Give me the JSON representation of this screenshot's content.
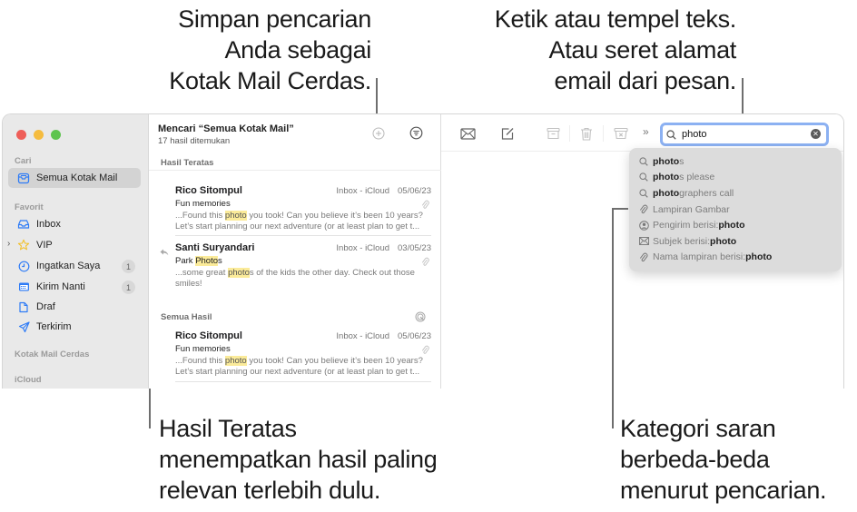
{
  "callouts": {
    "save_search": [
      "Simpan pencarian",
      "Anda sebagai",
      "Kotak Mail Cerdas."
    ],
    "type_paste": [
      "Ketik atau tempel teks.",
      "Atau seret alamat",
      "email dari pesan."
    ],
    "top_hits": [
      "Hasil Teratas",
      "menempatkan hasil paling",
      "relevan terlebih dulu."
    ],
    "categories": [
      "Kategori saran",
      "berbeda-beda",
      "menurut pencarian."
    ]
  },
  "sidebar": {
    "sections": {
      "search": "Cari",
      "favorites": "Favorit",
      "smart_mailboxes": "Kotak Mail Cerdas",
      "icloud": "iCloud"
    },
    "search_item": {
      "label": "Semua Kotak Mail",
      "icon": "all-mailboxes-icon",
      "selected": true
    },
    "favorites": [
      {
        "label": "Inbox",
        "icon": "inbox-icon",
        "badge": null
      },
      {
        "label": "VIP",
        "icon": "star-icon",
        "badge": null
      },
      {
        "label": "Ingatkan Saya",
        "icon": "clock-icon",
        "badge": "1"
      },
      {
        "label": "Kirim Nanti",
        "icon": "calendar-icon",
        "badge": "1"
      },
      {
        "label": "Draf",
        "icon": "document-icon",
        "badge": null
      },
      {
        "label": "Terkirim",
        "icon": "paper-plane-icon",
        "badge": null
      }
    ]
  },
  "message_list": {
    "title": "Mencari “Semua Kotak Mail”",
    "subtitle": "17 hasil ditemukan",
    "top_hits_label": "Hasil Teratas",
    "all_results_label": "Semua Hasil",
    "top_hits": [
      {
        "from": "Rico Sitompul",
        "mailbox": "Inbox - iCloud",
        "date": "05/06/23",
        "subject": [
          "Fun memories"
        ],
        "preview": [
          "...Found this ",
          "photo",
          " you took! Can you believe it’s been 10 years? Let’s start planning our next adventure (or at least plan to get t..."
        ],
        "attachment": true,
        "replied": false
      },
      {
        "from": "Santi Suryandari",
        "mailbox": "Inbox - iCloud",
        "date": "03/05/23",
        "subject": [
          "Park ",
          "Photo",
          "s"
        ],
        "preview": [
          "...some great ",
          "photo",
          "s of the kids the other day. Check out those smiles!"
        ],
        "attachment": true,
        "replied": true
      }
    ],
    "all_results": [
      {
        "from": "Rico Sitompul",
        "mailbox": "Inbox - iCloud",
        "date": "05/06/23",
        "subject": [
          "Fun memories"
        ],
        "preview": [
          "...Found this ",
          "photo",
          " you took! Can you believe it’s been 10 years? Let’s start planning our next adventure (or at least plan to get t..."
        ],
        "attachment": true
      }
    ]
  },
  "toolbar": {
    "buttons": [
      "get-mail",
      "compose",
      "archive",
      "delete",
      "junk"
    ],
    "more": "»"
  },
  "search": {
    "value": "photo",
    "suggestions": [
      {
        "icon": "search-icon",
        "prefix": "",
        "bold": "photo",
        "rest": "s"
      },
      {
        "icon": "search-icon",
        "prefix": "",
        "bold": "photo",
        "rest": "s please"
      },
      {
        "icon": "search-icon",
        "prefix": "",
        "bold": "photo",
        "rest": "graphers call"
      },
      {
        "icon": "paperclip-icon",
        "prefix": "Lampiran Gambar",
        "bold": "",
        "rest": ""
      },
      {
        "icon": "person-icon",
        "prefix": "Pengirim berisi: ",
        "bold": "photo",
        "rest": ""
      },
      {
        "icon": "envelope-icon",
        "prefix": "Subjek berisi: ",
        "bold": "photo",
        "rest": ""
      },
      {
        "icon": "paperclip-icon",
        "prefix": "Nama lampiran berisi: ",
        "bold": "photo",
        "rest": ""
      }
    ]
  },
  "colors": {
    "accent": "#2f7cf6",
    "highlight": "#fbeb9a",
    "search_focus": "#8cb1f2",
    "vip_star": "#f2c12e"
  }
}
